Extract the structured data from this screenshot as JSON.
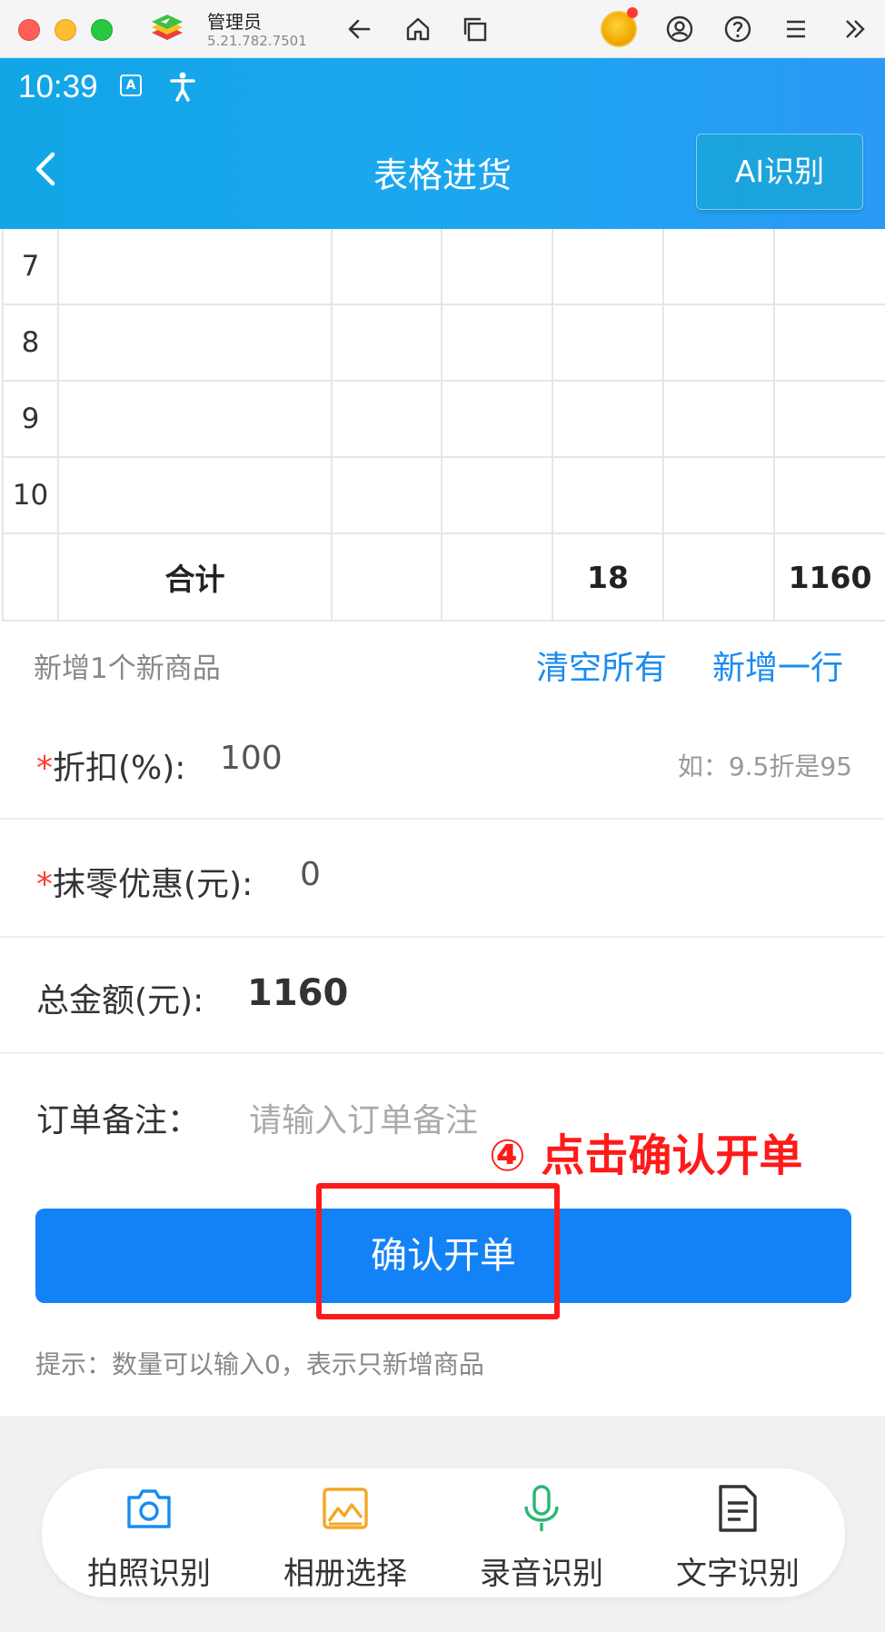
{
  "window": {
    "app_name": "管理员",
    "app_version": "5.21.782.7501"
  },
  "status_bar": {
    "time": "10:39",
    "a_icon_label": "A"
  },
  "header": {
    "title": "表格进货",
    "ai_button": "AI识别"
  },
  "table": {
    "rows": [
      {
        "no": "7"
      },
      {
        "no": "8"
      },
      {
        "no": "9"
      },
      {
        "no": "10"
      }
    ],
    "total": {
      "label": "合计",
      "quantity": "18",
      "amount": "1160"
    }
  },
  "actions": {
    "new_count": "新增1个新商品",
    "clear_all": "清空所有",
    "add_row": "新增一行"
  },
  "form": {
    "discount": {
      "required_mark": "*",
      "label": "折扣(%):",
      "value": "100",
      "hint": "如：9.5折是95"
    },
    "rounding": {
      "required_mark": "*",
      "label": "抹零优惠(元):",
      "value": "0"
    },
    "total": {
      "label": "总金额(元):",
      "value": "1160"
    },
    "remark": {
      "label": "订单备注：",
      "placeholder": "请输入订单备注"
    }
  },
  "annotation": "④ 点击确认开单",
  "confirm_button": "确认开单",
  "tip": "提示：数量可以输入0，表示只新增商品",
  "toolbar": [
    {
      "label": "拍照识别",
      "icon": "camera-icon",
      "color": "#1a8cf0"
    },
    {
      "label": "相册选择",
      "icon": "image-icon",
      "color": "#f5a623"
    },
    {
      "label": "录音识别",
      "icon": "microphone-icon",
      "color": "#2bb673"
    },
    {
      "label": "文字识别",
      "icon": "document-icon",
      "color": "#333333"
    }
  ],
  "colors": {
    "header_blue": "#1ba7ef",
    "primary_button": "#1382f6",
    "link_blue": "#1a8cf0",
    "annotation_red": "#ff1a1a"
  }
}
